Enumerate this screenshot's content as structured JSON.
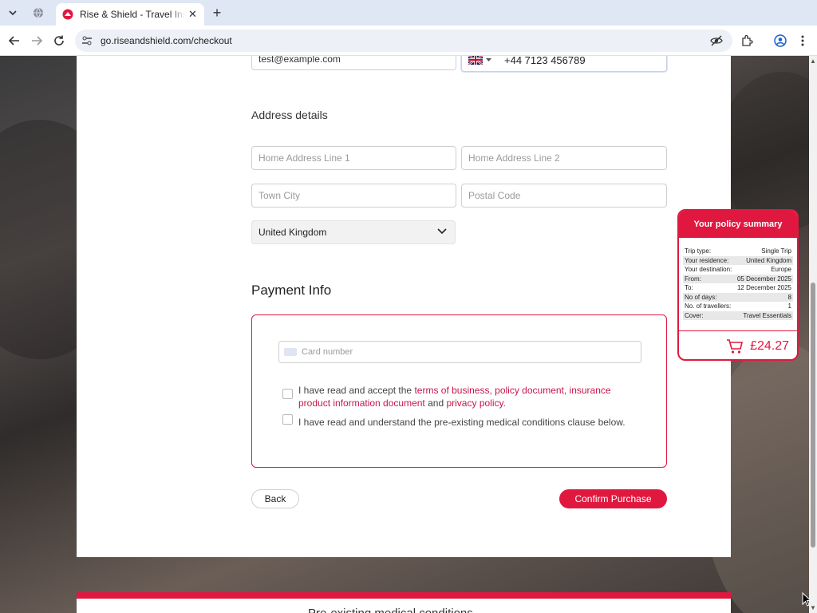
{
  "browser": {
    "tab_title": "Rise & Shield - Travel Insurance",
    "tab_close": "✕",
    "new_tab": "+",
    "url": "go.riseandshield.com/checkout"
  },
  "contact": {
    "email": "test@example.com",
    "phone": "+44 7123 456789"
  },
  "address": {
    "heading": "Address details",
    "line1_placeholder": "Home Address Line 1",
    "line2_placeholder": "Home Address Line 2",
    "town_placeholder": "Town City",
    "postal_placeholder": "Postal Code",
    "country": "United Kingdom"
  },
  "payment": {
    "heading": "Payment Info",
    "card_placeholder": "Card number",
    "terms_prefix": "I have read and accept the ",
    "terms_link1": "terms of business",
    "sep1": ", ",
    "terms_link2": "policy document",
    "sep2": ", ",
    "terms_link3": "insurance product information document",
    "terms_and": " and ",
    "terms_link4": "privacy policy",
    "terms_suffix": ".",
    "medical": "I have read and understand the pre-existing medical conditions clause below."
  },
  "buttons": {
    "back": "Back",
    "confirm": "Confirm Purchase"
  },
  "summary": {
    "title": "Your policy summary",
    "rows": [
      {
        "label": "Trip type:",
        "value": "Single Trip"
      },
      {
        "label": "Your residence:",
        "value": "United Kingdom"
      },
      {
        "label": "Your destination:",
        "value": "Europe"
      },
      {
        "label": "From:",
        "value": "05 December 2025"
      },
      {
        "label": "To:",
        "value": "12 December 2025"
      },
      {
        "label": "No of days:",
        "value": "8"
      },
      {
        "label": "No. of travellers:",
        "value": "1"
      },
      {
        "label": "Cover:",
        "value": "Travel Essentials"
      }
    ],
    "price": "£24.27"
  },
  "footer": {
    "text": "Pre-existing medical conditions"
  },
  "colors": {
    "brand": "#e0183f",
    "link": "#c8154a"
  }
}
